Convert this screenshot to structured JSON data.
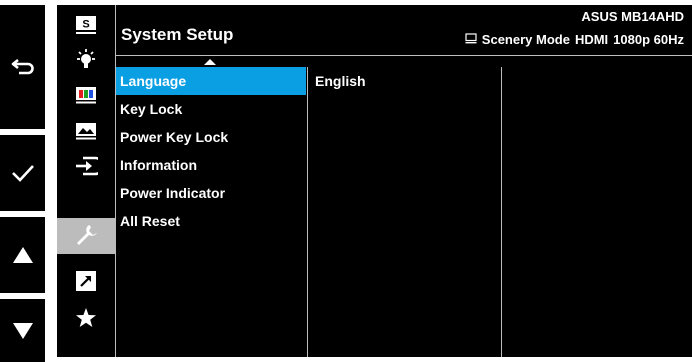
{
  "header": {
    "title": "System Setup",
    "model": "ASUS MB14AHD",
    "scenery_mode": "Scenery Mode",
    "input": "HDMI",
    "resolution": "1080p 60Hz"
  },
  "sidebar_icons": [
    {
      "name": "splendid-icon",
      "selected": false
    },
    {
      "name": "bluelight-filter-icon",
      "selected": false
    },
    {
      "name": "color-icon",
      "selected": false
    },
    {
      "name": "image-icon",
      "selected": false
    },
    {
      "name": "input-select-icon",
      "selected": false
    },
    {
      "name": "system-setup-icon",
      "selected": true
    },
    {
      "name": "shortcut-icon",
      "selected": false
    },
    {
      "name": "myfavorite-icon",
      "selected": false
    }
  ],
  "menu": {
    "items": [
      {
        "label": "Language",
        "selected": true
      },
      {
        "label": "Key Lock",
        "selected": false
      },
      {
        "label": "Power Key Lock",
        "selected": false
      },
      {
        "label": "Information",
        "selected": false
      },
      {
        "label": "Power Indicator",
        "selected": false
      },
      {
        "label": "All Reset",
        "selected": false
      }
    ]
  },
  "submenu": {
    "value": "English"
  },
  "keys": [
    {
      "name": "back-icon"
    },
    {
      "name": "check-icon"
    },
    {
      "name": "up-arrow-icon"
    },
    {
      "name": "down-arrow-icon"
    }
  ],
  "colors": {
    "highlight": "#0a9ee3",
    "selected_icon_bg": "#bcbcbc",
    "panel": "#000000"
  }
}
